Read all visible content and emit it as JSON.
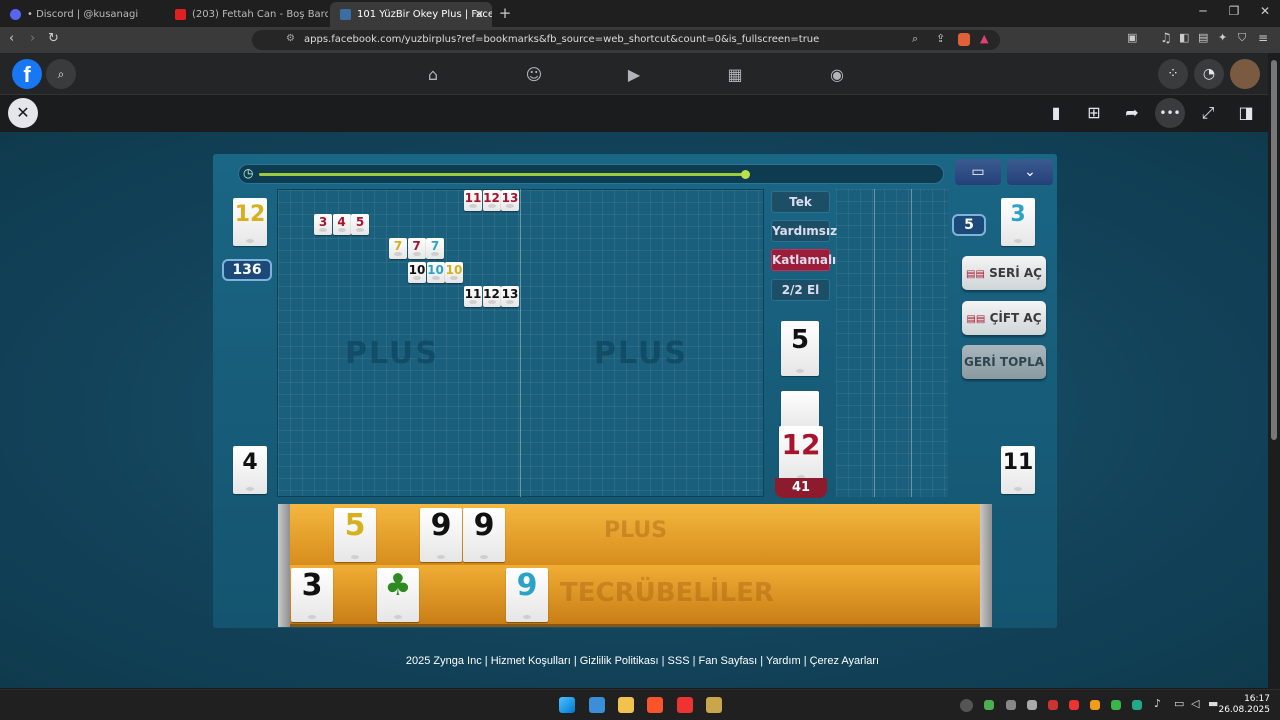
{
  "browser": {
    "tabs": [
      {
        "title": "• Discord | @kusanagi",
        "active": false
      },
      {
        "title": "(203) Fettah Can - Boş Bardak - Y",
        "active": false
      },
      {
        "title": "101 YüzBir Okey Plus | Facebook",
        "active": true
      }
    ],
    "new_tab": "+",
    "url": "apps.facebook.com/yuzbirplus?ref=bookmarks&fb_source=web_shortcut&count=0&is_fullscreen=true"
  },
  "game": {
    "table_tiles": [
      {
        "num": "11",
        "color": "red"
      },
      {
        "num": "12",
        "color": "red"
      },
      {
        "num": "13",
        "color": "red"
      },
      {
        "num": "3",
        "color": "red"
      },
      {
        "num": "4",
        "color": "red"
      },
      {
        "num": "5",
        "color": "red"
      },
      {
        "num": "7",
        "color": "yel"
      },
      {
        "num": "7",
        "color": "red"
      },
      {
        "num": "7",
        "color": "blu"
      },
      {
        "num": "10",
        "color": "blk"
      },
      {
        "num": "10",
        "color": "blu"
      },
      {
        "num": "10",
        "color": "yel"
      },
      {
        "num": "11",
        "color": "blk"
      },
      {
        "num": "12",
        "color": "blk"
      },
      {
        "num": "13",
        "color": "blk"
      }
    ],
    "left_top_tile": "12",
    "left_score": "136",
    "left_bottom_tile": "4",
    "right_top_tile": "3",
    "right_score": "5",
    "right_bottom_tile": "11",
    "info_buttons": [
      "Tek",
      "Yardımsız",
      "Katlamalı",
      "2/2 El"
    ],
    "indicator_tile": "5",
    "draw_tile": "12",
    "remaining_count": "41",
    "action_buttons": [
      "SERİ AÇ",
      "ÇİFT AÇ",
      "GERİ TOPLA"
    ],
    "rack_top": [
      {
        "num": "5",
        "color": "yel"
      },
      {
        "num": "9",
        "color": "blk"
      },
      {
        "num": "9",
        "color": "blk"
      }
    ],
    "rack_bottom": [
      {
        "num": "3",
        "color": "blk"
      },
      {
        "num": "♣",
        "color": "grn"
      },
      {
        "num": "9",
        "color": "blu"
      }
    ],
    "watermark": "PLUS",
    "rack_watermark": "TECRÜBELİLER",
    "rack_logo": "PLUS",
    "timer_progress": 0.73
  },
  "footer": "2025 Zynga Inc | Hizmet Koşulları | Gizlilik Politikası | SSS | Fan Sayfası | Yardım | Çerez Ayarları",
  "taskbar": {
    "time": "16:17",
    "date": "26.08.2025"
  },
  "colors": {
    "fb_blue": "#1877f2",
    "rack_orange": "#e9a030",
    "timer_green": "#9ccc3c",
    "highlight_red": "#9b1d3a"
  }
}
